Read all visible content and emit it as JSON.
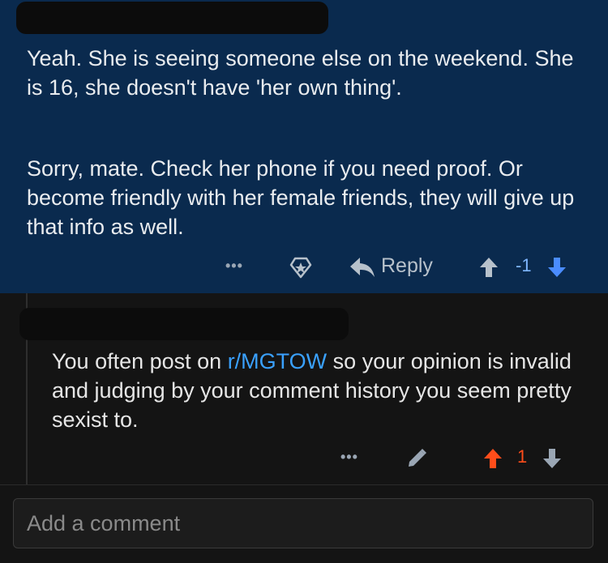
{
  "comment1": {
    "paragraphs": [
      "Yeah. She is seeing someone else on the weekend. She is 16, she doesn't have 'her own thing'.",
      "Sorry, mate. Check her phone if you need proof. Or become friendly with her female friends, they will give up that info as well."
    ],
    "actions": {
      "more": "•••",
      "reply_label": "Reply",
      "score": "-1"
    }
  },
  "comment2": {
    "text_before": "You often post on ",
    "link": "r/MGTOW",
    "text_after": " so your opinion is invalid and judging by your comment history you seem pretty sexist to.",
    "actions": {
      "more": "•••",
      "score": "1"
    }
  },
  "composer": {
    "placeholder": "Add a comment"
  },
  "colors": {
    "comment1_bg": "#0a2a4e",
    "link": "#3aa1ff",
    "upvote_active": "#ff4d1a",
    "downvote_active": "#4a8cff"
  },
  "icons": [
    "star-badge-icon",
    "reply-arrow-icon",
    "upvote-arrow-icon",
    "downvote-arrow-icon",
    "pencil-icon"
  ]
}
